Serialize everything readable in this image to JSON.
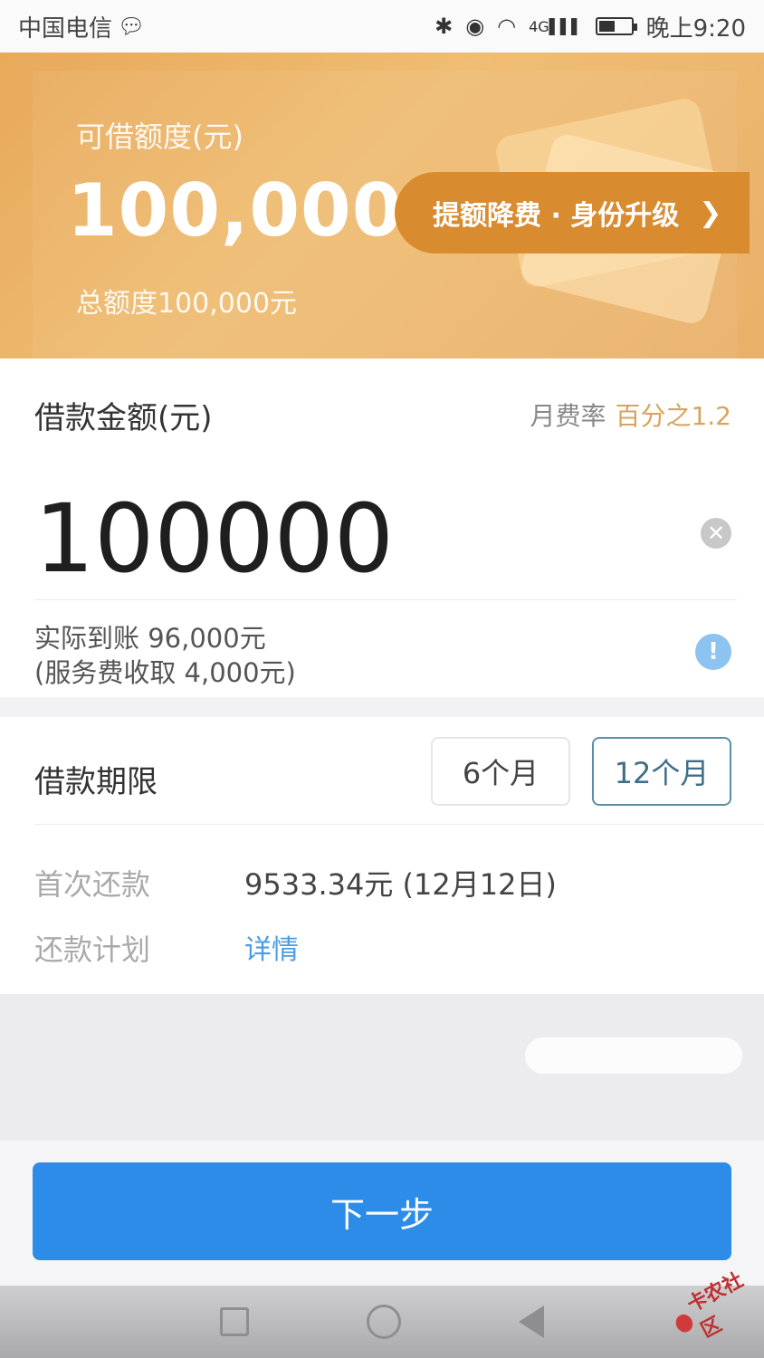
{
  "status_bar": {
    "carrier": "中国电信",
    "network": "4G",
    "time": "晚上9:20",
    "battery_level": 0.5
  },
  "banner": {
    "limit_label": "可借额度(元)",
    "limit_amount": "100,000",
    "total_limit": "总额度100,000元",
    "upgrade_button": "提额降费 · 身份升级"
  },
  "amount": {
    "title": "借款金额(元)",
    "rate_label": "月费率",
    "rate_value": "百分之1.2",
    "input_value": "100000",
    "actual_received": "实际到账 96,000元",
    "service_fee": "(服务费收取 4,000元)"
  },
  "term": {
    "title": "借款期限",
    "options": [
      "6个月",
      "12个月"
    ],
    "selected": "12个月",
    "first_payment_label": "首次还款",
    "first_payment_value": "9533.34元 (12月12日)",
    "plan_label": "还款计划",
    "plan_link": "详情"
  },
  "next_button": "下一步",
  "watermark": "卡农社区"
}
